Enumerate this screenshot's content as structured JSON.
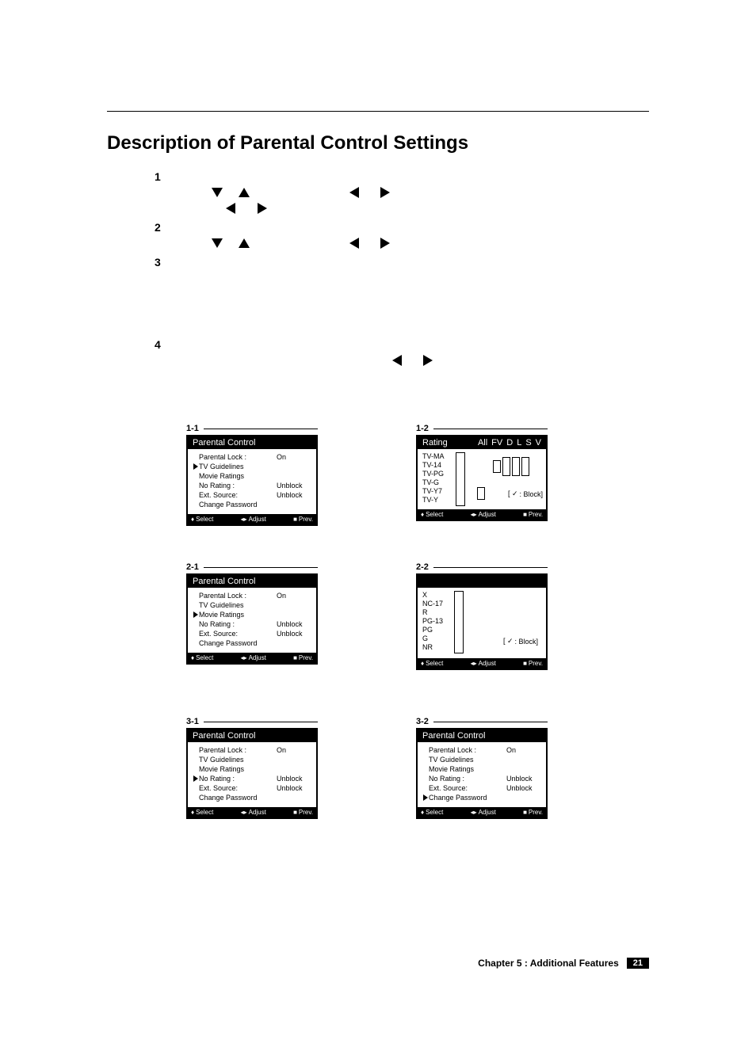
{
  "title": "Description of Parental Control Settings",
  "steps": {
    "s1": {
      "num": "1"
    },
    "s2": {
      "num": "2"
    },
    "s3": {
      "num": "3"
    },
    "s4": {
      "num": "4"
    }
  },
  "osd_labels": {
    "parental_control": "Parental Control",
    "parental_lock": "Parental Lock :",
    "on": "On",
    "tv_guidelines": "TV Guidelines",
    "movie_ratings": "Movie Ratings",
    "no_rating": "No Rating :",
    "ext_source": "Ext. Source:",
    "unblock": "Unblock",
    "change_password": "Change Password",
    "rating": "Rating",
    "all": "All",
    "fv": "FV",
    "d": "D",
    "l": "L",
    "s": "S",
    "v": "V",
    "tvma": "TV-MA",
    "tv14": "TV-14",
    "tvpg": "TV-PG",
    "tvg": "TV-G",
    "tvy7": "TV-Y7",
    "tvy": "TV-Y",
    "block_note": ": Block]",
    "x": "X",
    "nc17": "NC-17",
    "r": "R",
    "pg13": "PG-13",
    "pg": "PG",
    "g": "G",
    "nr": "NR"
  },
  "footer_bar": {
    "select": "Select",
    "adjust": "Adjust",
    "prev": "Prev."
  },
  "screen_nums": {
    "s11": "1-1",
    "s12": "1-2",
    "s21": "2-1",
    "s22": "2-2",
    "s31": "3-1",
    "s32": "3-2"
  },
  "page_footer": {
    "chapter": "Chapter 5 : Additional Features",
    "page": "21"
  }
}
